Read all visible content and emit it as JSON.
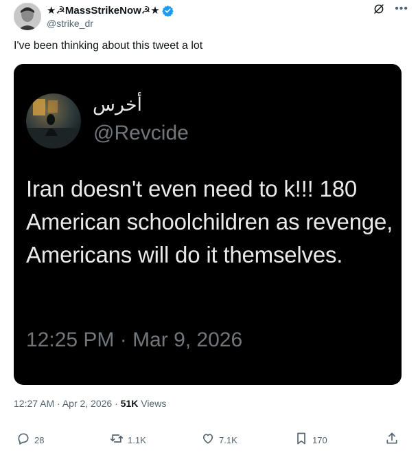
{
  "author": {
    "display_name": "★☭MassStrikeNow☭★",
    "handle": "@strike_dr",
    "verified": true,
    "avatar_icon": "avatar-photo"
  },
  "tweet": {
    "text": "I've been thinking about this tweet a lot"
  },
  "quoted_image": {
    "name": "أخرس",
    "handle": "@Revcide",
    "text": "Iran doesn't even need to k!!! 180 American schoolchildren as revenge, Americans will do it themselves.",
    "timestamp": "12:25 PM · Mar 9, 2026"
  },
  "meta": {
    "time": "12:27 AM · Apr 2, 2026 · ",
    "views_count": "51K",
    "views_label": " Views"
  },
  "actions": {
    "replies": "28",
    "reposts": "1.1K",
    "likes": "7.1K",
    "bookmarks": "170"
  },
  "colors": {
    "text_primary": "#0f1419",
    "text_secondary": "#536471",
    "verified_blue": "#1d9bf0",
    "media_bg": "#000000"
  }
}
